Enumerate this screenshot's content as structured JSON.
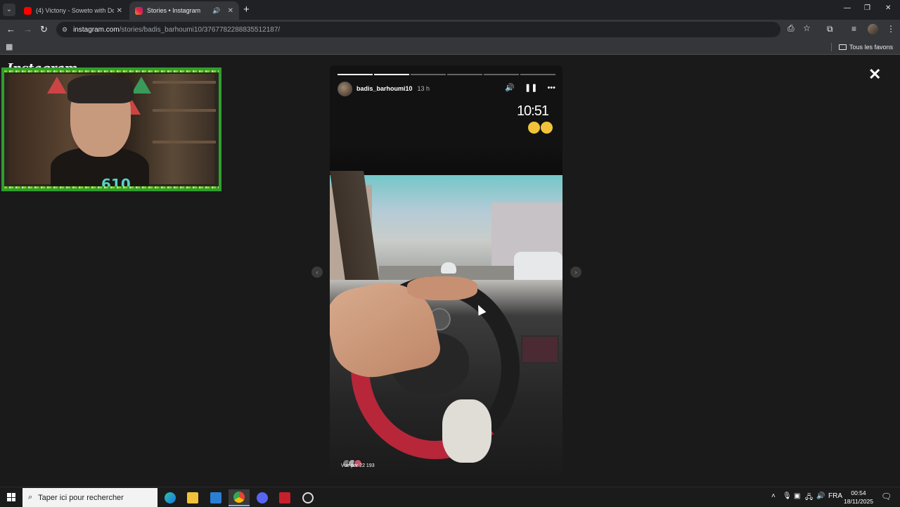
{
  "browser": {
    "tabs": [
      {
        "title": "(4) Victony - Soweto with Don T",
        "favicon_color": "#ff0000",
        "active": false
      },
      {
        "title": "Stories • Instagram",
        "favicon_color": "#d6249f",
        "active": true
      }
    ],
    "url_host": "instagram.com",
    "url_path": "/stories/badis_barhoumi10/3767782288835512187/",
    "bookmarks_folder": "Tous les favons"
  },
  "page": {
    "logo": "Instagram",
    "stream_overlay_logo": "610"
  },
  "story": {
    "username": "badis_barhoumi10",
    "time_ago": "13 h",
    "progress_segments": 6,
    "progress_done": 2,
    "overlay_time": "10:51",
    "emoji_count": 2,
    "views_label": "Vue par 22 193"
  },
  "taskbar": {
    "search_placeholder": "Taper ici pour rechercher",
    "language": "FRA",
    "time": "00:54",
    "date": "18/11/2025"
  }
}
